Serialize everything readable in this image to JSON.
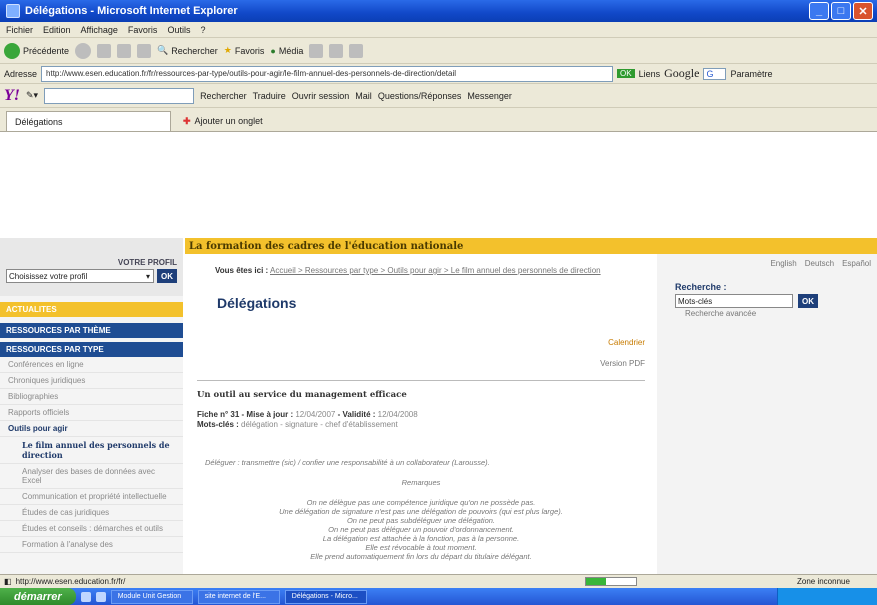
{
  "window": {
    "title": "Délégations - Microsoft Internet Explorer"
  },
  "menu": [
    "Fichier",
    "Edition",
    "Affichage",
    "Favoris",
    "Outils",
    "?"
  ],
  "toolbar": {
    "back": "Précédente",
    "search": "Rechercher",
    "favorites": "Favoris",
    "media": "Média"
  },
  "address": {
    "label": "Adresse",
    "url": "http://www.esen.education.fr/fr/ressources-par-type/outils-pour-agir/le-film-annuel-des-personnels-de-direction/detail",
    "go": "OK",
    "links": "Liens",
    "google": "Google",
    "google_field": "G",
    "params": "Paramètre"
  },
  "yahoobar": {
    "logo": "Y!",
    "search": "Rechercher",
    "translate": "Traduire",
    "session": "Ouvrir session",
    "mail": "Mail",
    "qa": "Questions/Réponses",
    "messenger": "Messenger"
  },
  "tabs": {
    "active": "Délégations",
    "new": "Ajouter un onglet"
  },
  "site": {
    "banner": "La formation des cadres de l'éducation nationale",
    "profile_label": "VOTRE PROFIL",
    "profile_select": "Choisissez votre profil",
    "ok": "OK",
    "sections": {
      "actualites": "ACTUALITES",
      "theme": "RESSOURCES PAR THÈME",
      "type": "RESSOURCES PAR TYPE"
    },
    "side_items": [
      "Conférences en ligne",
      "Chroniques juridiques",
      "Bibliographies",
      "Rapports officiels"
    ],
    "outils": "Outils pour agir",
    "sub_items": [
      "Le film annuel des personnels de direction",
      "Analyser des bases de données avec Excel",
      "Communication et propriété intellectuelle",
      "Études de cas juridiques",
      "Études et conseils : démarches et outils",
      "Formation à l'analyse des"
    ],
    "breadcrumb_prefix": "Vous êtes ici :",
    "breadcrumb": "Accueil > Ressources par type > Outils pour agir > Le film annuel des personnels de direction",
    "page_title": "Délégations",
    "calendar": "Calendrier",
    "pdf": "Version PDF",
    "subtitle": "Un outil au service du management efficace",
    "meta_line1_label": "Fiche n° 31 - Mise à jour :",
    "meta_line1_value": "12/04/2007",
    "meta_validite_label": "- Validité :",
    "meta_validite_value": "12/04/2008",
    "meta_line2_label": "Mots-clés :",
    "meta_line2_value": "délégation - signature - chef d'établissement",
    "definition": "Déléguer : transmettre (sic) / confier une responsabilité à un collaborateur (Larousse).",
    "remarks_title": "Remarques",
    "remarks": [
      "On ne délègue pas une compétence juridique qu'on ne possède pas.",
      "Une délégation de signature n'est pas une délégation de pouvoirs (qui est plus large).",
      "On ne peut pas subdéléguer une délégation.",
      "On ne peut pas déléguer un pouvoir d'ordonnancement.",
      "La délégation est attachée à la fonction, pas à la personne.",
      "Elle est révocable à tout moment.",
      "Elle prend automatiquement fin lors du départ du titulaire délégant."
    ],
    "langs": [
      "English",
      "Deutsch",
      "Español"
    ],
    "search_label": "Recherche :",
    "search_value": "Mots-clés",
    "search_ok": "OK",
    "advanced": "Recherche avancée"
  },
  "status": {
    "url": "http://www.esen.education.fr/fr/",
    "zone": "Zone inconnue",
    "progress": 0.4
  },
  "taskbar": {
    "start": "démarrer",
    "items": [
      "Module Unit Gestion",
      "site internet de l'E...",
      "Délégations - Micro..."
    ]
  }
}
